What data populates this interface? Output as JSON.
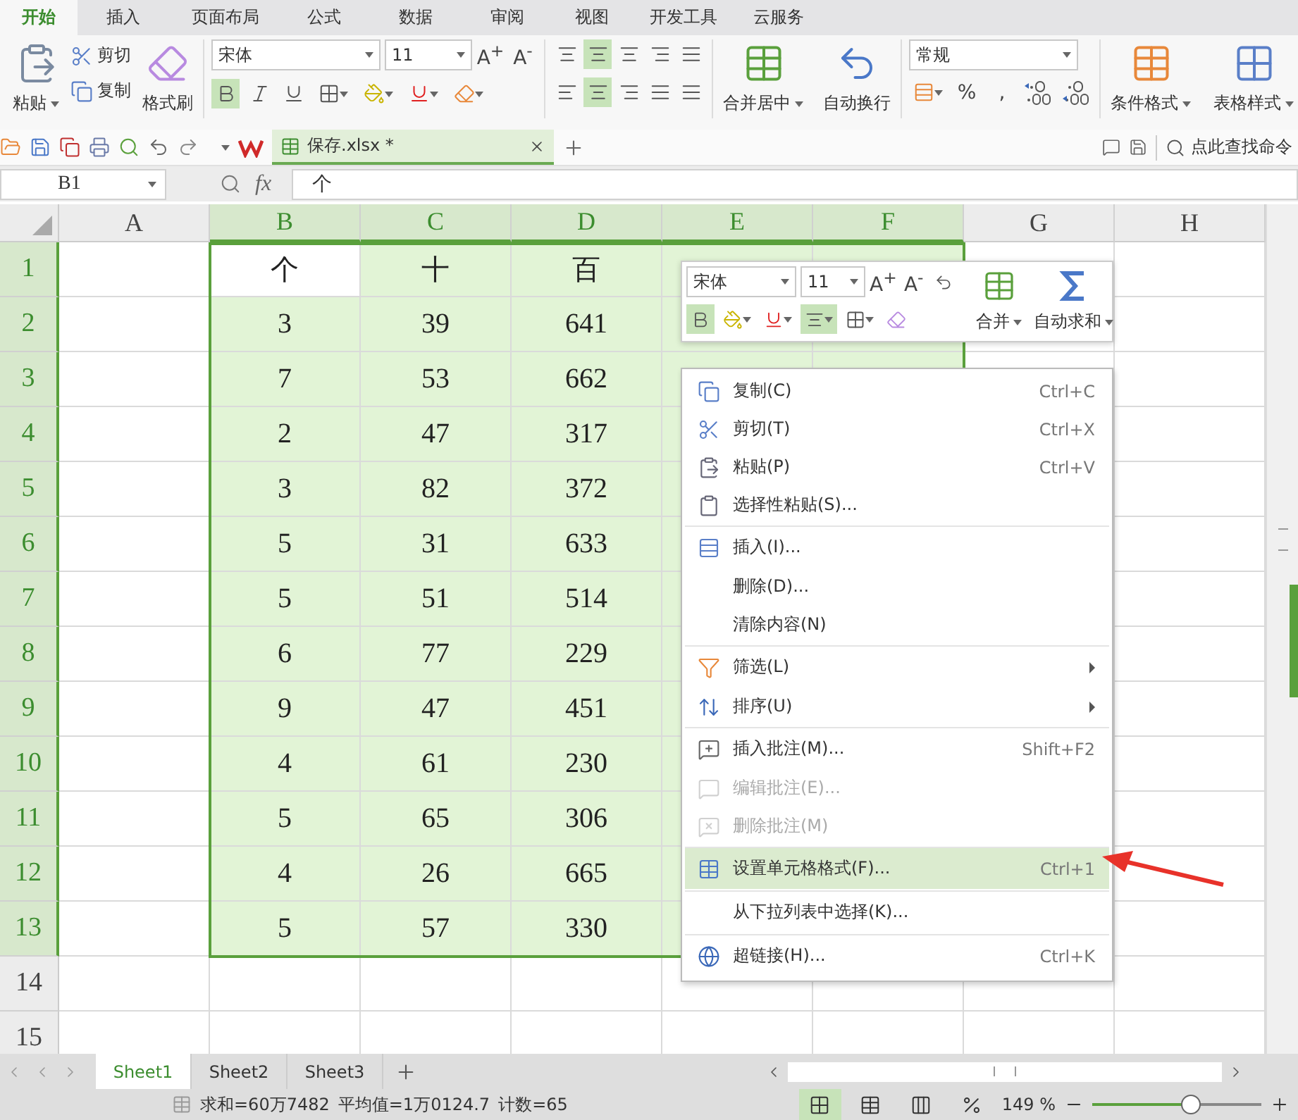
{
  "menu_tabs": [
    {
      "label": "开始",
      "selected": true
    },
    {
      "label": "插入",
      "selected": false
    },
    {
      "label": "页面布局",
      "selected": false
    },
    {
      "label": "公式",
      "selected": false
    },
    {
      "label": "数据",
      "selected": false
    },
    {
      "label": "审阅",
      "selected": false
    },
    {
      "label": "视图",
      "selected": false
    },
    {
      "label": "开发工具",
      "selected": false
    },
    {
      "label": "云服务",
      "selected": false
    }
  ],
  "ribbon": {
    "paste": "粘贴",
    "cut": "剪切",
    "copy": "复制",
    "format_painter": "格式刷",
    "font": "宋体",
    "font_size": "11",
    "grow_font": "A$^{+}$",
    "shrink_font": "A$^{-}$",
    "bold_selected": true,
    "align_buttons": [
      {
        "selected": false
      },
      {
        "selected": true
      },
      {
        "selected": false
      },
      {
        "selected": false
      },
      {
        "selected": false
      },
      {
        "selected": false
      },
      {
        "selected": true
      },
      {
        "selected": false
      },
      {
        "selected": false
      },
      {
        "selected": false
      }
    ],
    "merge": "合并居中",
    "wrap": "自动换行",
    "number_format": "常规",
    "percent": "%",
    "comma": ",",
    "conditional_format": "条件格式",
    "table_style": "表格样式"
  },
  "document_tab": {
    "title": "保存.xlsx *",
    "selected": true
  },
  "command_search": "点此查找命令",
  "name_box": "B1",
  "fx": "fx",
  "formula": "个",
  "columns": [
    {
      "label": "A",
      "selected": false
    },
    {
      "label": "B",
      "selected": true
    },
    {
      "label": "C",
      "selected": true
    },
    {
      "label": "D",
      "selected": true
    },
    {
      "label": "E",
      "selected": true
    },
    {
      "label": "F",
      "selected": true
    },
    {
      "label": "G",
      "selected": false
    },
    {
      "label": "H",
      "selected": false
    }
  ],
  "rows": [
    {
      "label": "1",
      "selected": true,
      "values": [
        {
          "text": "个",
          "active": true
        },
        {
          "text": "十",
          "active": false
        },
        {
          "text": "百",
          "active": false
        }
      ]
    },
    {
      "label": "2",
      "selected": true,
      "values": [
        {
          "text": "3",
          "active": false
        },
        {
          "text": "39",
          "active": false
        },
        {
          "text": "641",
          "active": false
        }
      ]
    },
    {
      "label": "3",
      "selected": true,
      "values": [
        {
          "text": "7",
          "active": false
        },
        {
          "text": "53",
          "active": false
        },
        {
          "text": "662",
          "active": false
        }
      ]
    },
    {
      "label": "4",
      "selected": true,
      "values": [
        {
          "text": "2",
          "active": false
        },
        {
          "text": "47",
          "active": false
        },
        {
          "text": "317",
          "active": false
        }
      ]
    },
    {
      "label": "5",
      "selected": true,
      "values": [
        {
          "text": "3",
          "active": false
        },
        {
          "text": "82",
          "active": false
        },
        {
          "text": "372",
          "active": false
        }
      ]
    },
    {
      "label": "6",
      "selected": true,
      "values": [
        {
          "text": "5",
          "active": false
        },
        {
          "text": "31",
          "active": false
        },
        {
          "text": "633",
          "active": false
        }
      ]
    },
    {
      "label": "7",
      "selected": true,
      "values": [
        {
          "text": "5",
          "active": false
        },
        {
          "text": "51",
          "active": false
        },
        {
          "text": "514",
          "active": false
        }
      ]
    },
    {
      "label": "8",
      "selected": true,
      "values": [
        {
          "text": "6",
          "active": false
        },
        {
          "text": "77",
          "active": false
        },
        {
          "text": "229",
          "active": false
        }
      ]
    },
    {
      "label": "9",
      "selected": true,
      "values": [
        {
          "text": "9",
          "active": false
        },
        {
          "text": "47",
          "active": false
        },
        {
          "text": "451",
          "active": false
        }
      ]
    },
    {
      "label": "10",
      "selected": true,
      "values": [
        {
          "text": "4",
          "active": false
        },
        {
          "text": "61",
          "active": false
        },
        {
          "text": "230",
          "active": false
        }
      ]
    },
    {
      "label": "11",
      "selected": true,
      "values": [
        {
          "text": "5",
          "active": false
        },
        {
          "text": "65",
          "active": false
        },
        {
          "text": "306",
          "active": false
        }
      ]
    },
    {
      "label": "12",
      "selected": true,
      "values": [
        {
          "text": "4",
          "active": false
        },
        {
          "text": "26",
          "active": false
        },
        {
          "text": "665",
          "active": false
        }
      ]
    },
    {
      "label": "13",
      "selected": true,
      "values": [
        {
          "text": "5",
          "active": false
        },
        {
          "text": "57",
          "active": false
        },
        {
          "text": "330",
          "active": false
        }
      ]
    },
    {
      "label": "14",
      "selected": false,
      "values": []
    },
    {
      "label": "15",
      "selected": false,
      "values": []
    }
  ],
  "mini_toolbar": {
    "font": "宋体",
    "font_size": "11",
    "grow_font": "A$^{+}$",
    "shrink_font": "A$^{-}$",
    "bold_selected": true,
    "align_selected": true,
    "merge": "合并",
    "autosum": "自动求和"
  },
  "context_menu": {
    "items": [
      {
        "label": "复制(C)",
        "shortcut": "Ctrl+C",
        "disabled": false,
        "selected": false,
        "submenu": false,
        "separator_before": false
      },
      {
        "label": "剪切(T)",
        "shortcut": "Ctrl+X",
        "disabled": false,
        "selected": false,
        "submenu": false,
        "separator_before": false
      },
      {
        "label": "粘贴(P)",
        "shortcut": "Ctrl+V",
        "disabled": false,
        "selected": false,
        "submenu": false,
        "separator_before": false
      },
      {
        "label": "选择性粘贴(S)...",
        "disabled": false,
        "selected": false,
        "submenu": false,
        "separator_before": false
      },
      {
        "label": "插入(I)...",
        "disabled": false,
        "selected": false,
        "submenu": false,
        "separator_before": true
      },
      {
        "label": "删除(D)...",
        "disabled": false,
        "selected": false,
        "submenu": false,
        "separator_before": false
      },
      {
        "label": "清除内容(N)",
        "disabled": false,
        "selected": false,
        "submenu": false,
        "separator_before": false
      },
      {
        "label": "筛选(L)",
        "disabled": false,
        "selected": false,
        "submenu": true,
        "separator_before": true
      },
      {
        "label": "排序(U)",
        "disabled": false,
        "selected": false,
        "submenu": true,
        "separator_before": false
      },
      {
        "label": "插入批注(M)...",
        "shortcut": "Shift+F2",
        "disabled": false,
        "selected": false,
        "submenu": false,
        "separator_before": true
      },
      {
        "label": "编辑批注(E)...",
        "disabled": true,
        "selected": false,
        "submenu": false,
        "separator_before": false
      },
      {
        "label": "删除批注(M)",
        "disabled": true,
        "selected": false,
        "submenu": false,
        "separator_before": false
      },
      {
        "label": "设置单元格格式(F)...",
        "shortcut": "Ctrl+1",
        "disabled": false,
        "selected": true,
        "submenu": false,
        "separator_before": true
      },
      {
        "label": "从下拉列表中选择(K)...",
        "disabled": false,
        "selected": false,
        "submenu": false,
        "separator_before": true
      },
      {
        "label": "超链接(H)...",
        "shortcut": "Ctrl+K",
        "disabled": false,
        "selected": false,
        "submenu": false,
        "separator_before": true
      }
    ]
  },
  "sheets": [
    {
      "label": "Sheet1",
      "selected": true
    },
    {
      "label": "Sheet2",
      "selected": false
    },
    {
      "label": "Sheet3",
      "selected": false
    }
  ],
  "status_bar": {
    "sum": "求和=60万7482",
    "average": "平均值=1万0124.7",
    "count": "计数=65",
    "zoom": "149 %",
    "zoom_slider": {
      "level": 0.58
    }
  }
}
